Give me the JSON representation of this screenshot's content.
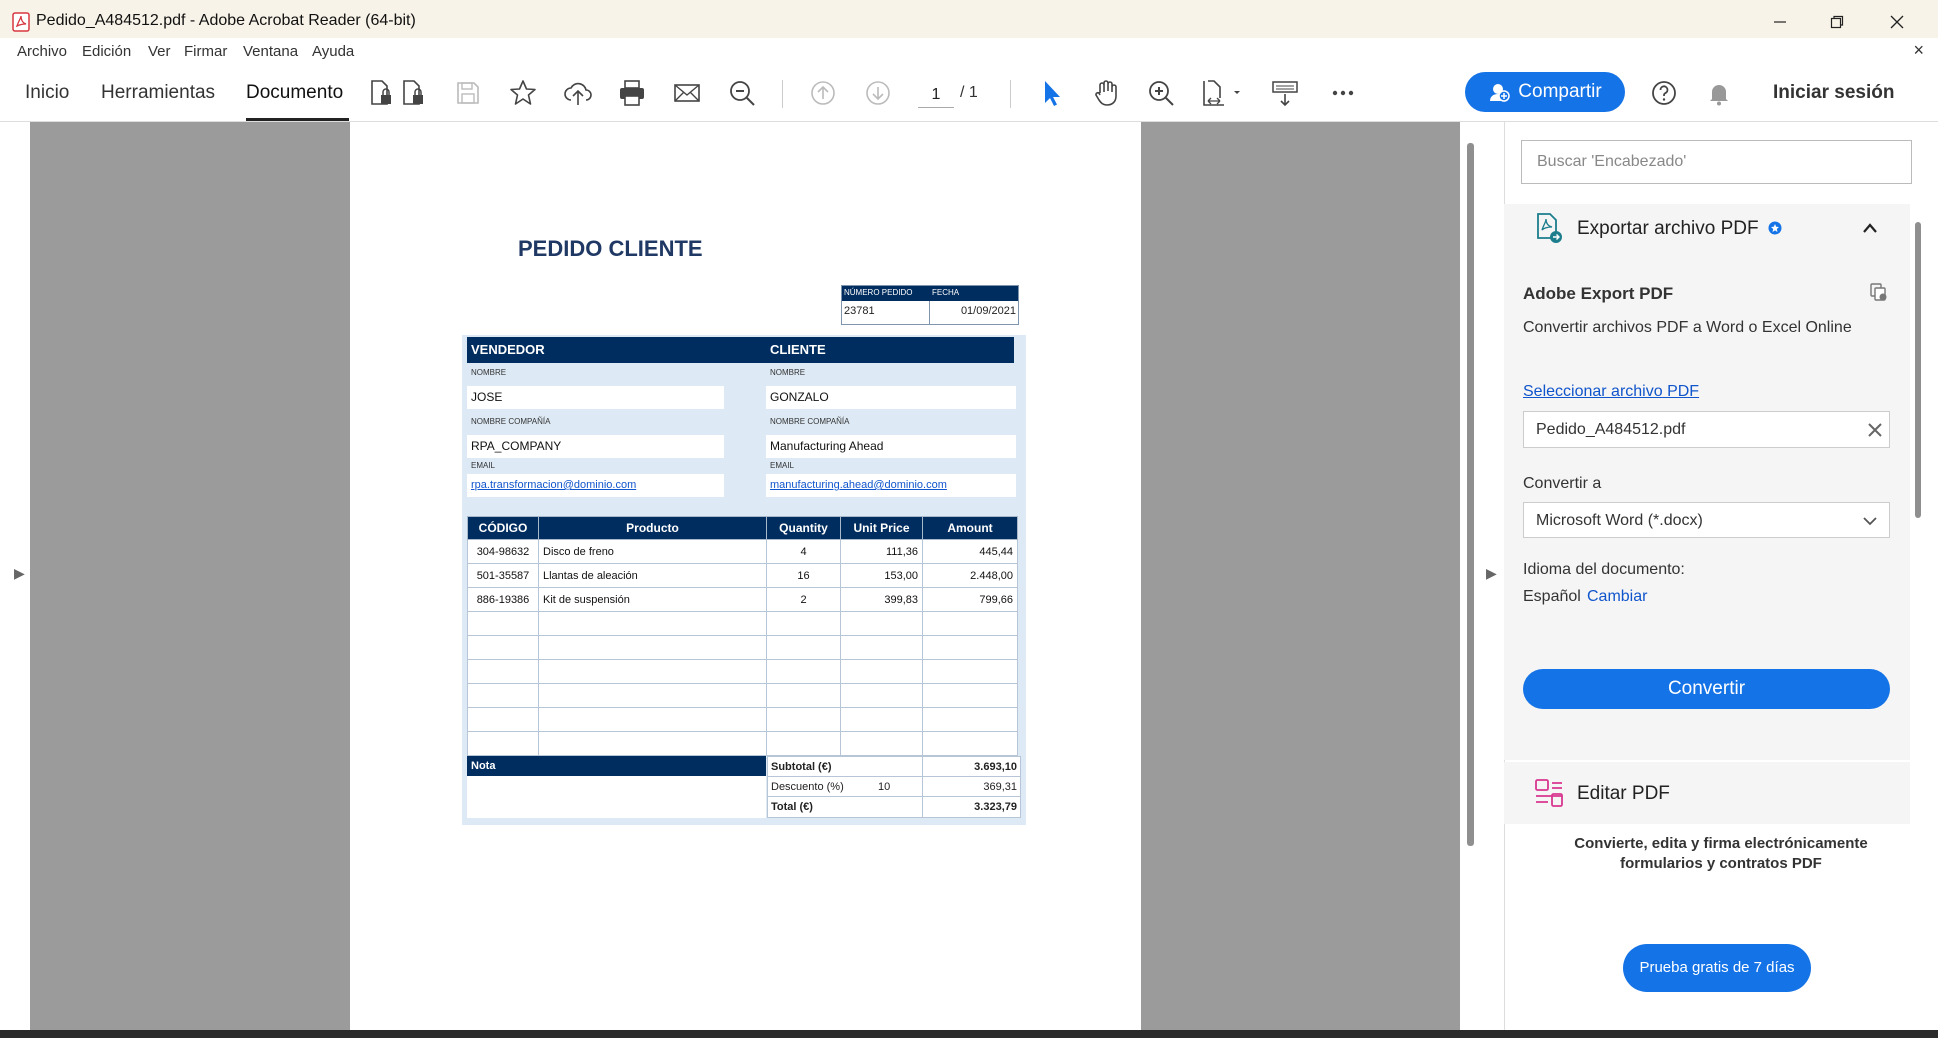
{
  "window": {
    "title": "Pedido_A484512.pdf - Adobe Acrobat Reader (64-bit)",
    "close_doc": "×"
  },
  "menu": [
    "Archivo",
    "Edición",
    "Ver",
    "Firmar",
    "Ventana",
    "Ayuda"
  ],
  "toolbar": {
    "tabs": [
      "Inicio",
      "Herramientas",
      "Documento"
    ],
    "active_tab": "Documento",
    "page_current": "1",
    "page_total": "/ 1",
    "share_label": "Compartir",
    "signin_label": "Iniciar sesión",
    "accent_color": "#1473e6"
  },
  "document": {
    "title": "PEDIDO CLIENTE",
    "order_number_label": "NÚMERO PEDIDO",
    "order_date_label": "FECHA",
    "order_number": "23781",
    "order_date": "01/09/2021",
    "seller_header": "VENDEDOR",
    "client_header": "CLIENTE",
    "name_label": "NOMBRE",
    "company_label": "NOMBRE COMPAÑÍA",
    "email_label": "EMAIL",
    "seller_name": "JOSE",
    "seller_company": "RPA_COMPANY",
    "seller_email": "rpa.transformacion@dominio.com",
    "client_name": "GONZALO",
    "client_company": "Manufacturing Ahead",
    "client_email": "manufacturing.ahead@dominio.com",
    "columns": [
      "CÓDIGO",
      "Producto",
      "Quantity",
      "Unit Price",
      "Amount"
    ],
    "rows": [
      {
        "code": "304-98632",
        "product": "Disco de freno",
        "qty": "4",
        "price": "111,36",
        "amount": "445,44"
      },
      {
        "code": "501-35587",
        "product": "Llantas de aleación",
        "qty": "16",
        "price": "153,00",
        "amount": "2.448,00"
      },
      {
        "code": "886-19386",
        "product": "Kit de suspensión",
        "qty": "2",
        "price": "399,83",
        "amount": "799,66"
      }
    ],
    "note_label": "Nota",
    "subtotal_label": "Subtotal (€)",
    "subtotal": "3.693,10",
    "discount_label": "Descuento (%)",
    "discount_pct": "10",
    "discount": "369,31",
    "total_label": "Total (€)",
    "total": "3.323,79"
  },
  "right_panel": {
    "search_placeholder": "Buscar 'Encabezado'",
    "export_title": "Exportar archivo PDF",
    "service_title": "Adobe Export PDF",
    "service_desc": "Convertir archivos PDF a Word o Excel Online",
    "select_link": "Seleccionar archivo PDF",
    "selected_file": "Pedido_A484512.pdf",
    "convert_to_label": "Convertir a",
    "format_option": "Microsoft Word (*.docx)",
    "language_label": "Idioma del documento:",
    "language": "Español",
    "change_link": "Cambiar",
    "convert_button": "Convertir",
    "edit_title": "Editar PDF",
    "promo_line1": "Convierte, edita y firma electrónicamente",
    "promo_line2": "formularios y contratos PDF",
    "trial_button": "Prueba gratis de 7 días"
  }
}
